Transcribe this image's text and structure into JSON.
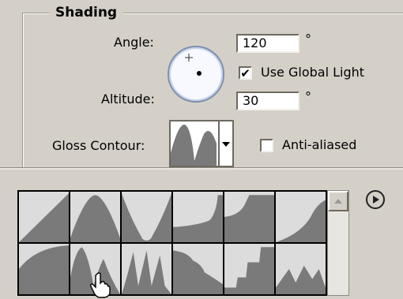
{
  "section": {
    "title": "Shading"
  },
  "angle": {
    "label": "Angle:",
    "value": "120",
    "unit": "°"
  },
  "use_global_light": {
    "label": "Use Global Light",
    "checked": true
  },
  "altitude": {
    "label": "Altitude:",
    "value": "30",
    "unit": "°"
  },
  "gloss_contour": {
    "label": "Gloss Contour:"
  },
  "anti_aliased": {
    "label": "Anti-aliased",
    "checked": false
  },
  "contour_presets": {
    "count_visible": 12,
    "icons": [
      "linear-contour-icon",
      "cone-contour-icon",
      "cove-deep-contour-icon",
      "cove-shallow-contour-icon",
      "gaussian-contour-icon",
      "half-round-contour-icon",
      "ring-contour-icon",
      "ring-double-contour-icon",
      "ring-triple-contour-icon",
      "rolling-slope-contour-icon",
      "rounded-steps-contour-icon",
      "sawtooth-contour-icon"
    ]
  },
  "icons": {
    "menu": "play-circle-icon",
    "cursor": "hand-pointer-icon",
    "dropdown": "triangle-down-icon"
  },
  "colors": {
    "panel": "#d4d0c8",
    "curve": "#7a7a7a",
    "dial_border": "#7e8fae"
  }
}
